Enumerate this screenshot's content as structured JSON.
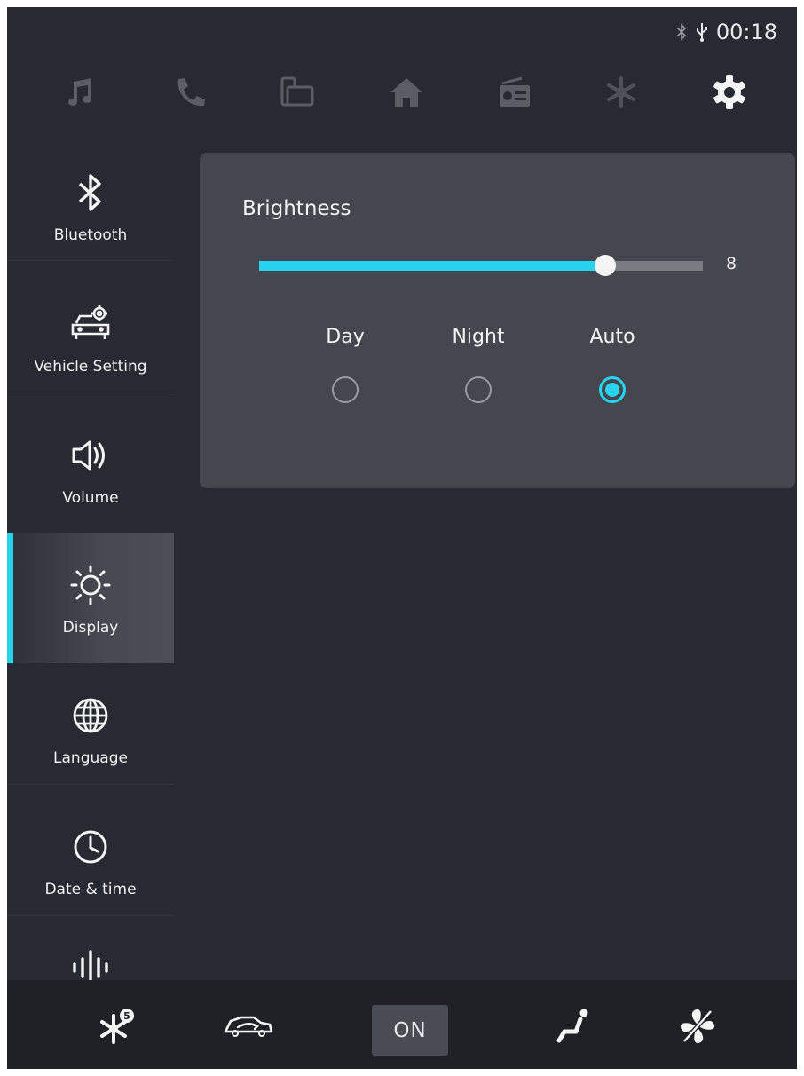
{
  "status": {
    "time": "00:18",
    "icons": [
      "bluetooth-icon",
      "usb-icon"
    ]
  },
  "topnav": {
    "items": [
      {
        "icon": "music-icon",
        "active": false
      },
      {
        "icon": "phone-icon",
        "active": false
      },
      {
        "icon": "screen-mirror-icon",
        "active": false
      },
      {
        "icon": "home-icon",
        "active": false
      },
      {
        "icon": "radio-icon",
        "active": false
      },
      {
        "icon": "climate-icon",
        "active": false
      },
      {
        "icon": "settings-gear-icon",
        "active": true
      }
    ]
  },
  "sidebar": {
    "items": [
      {
        "label": "Bluetooth",
        "icon": "bluetooth-icon"
      },
      {
        "label": "Vehicle Setting",
        "icon": "vehicle-setting-icon"
      },
      {
        "label": "Volume",
        "icon": "speaker-icon"
      },
      {
        "label": "Display",
        "icon": "sun-icon",
        "active": true
      },
      {
        "label": "Language",
        "icon": "globe-icon"
      },
      {
        "label": "Date & time",
        "icon": "clock-icon"
      },
      {
        "label": "",
        "icon": "equalizer-icon"
      }
    ]
  },
  "display": {
    "title": "Brightness",
    "brightness_value": "8",
    "brightness_fraction": 0.78,
    "modes": [
      {
        "label": "Day",
        "selected": false
      },
      {
        "label": "Night",
        "selected": false
      },
      {
        "label": "Auto",
        "selected": true
      }
    ]
  },
  "bottombar": {
    "on_label": "ON",
    "fan_speed_badge": "5",
    "icons": [
      "ac-fan-speed-icon",
      "air-recirculation-icon",
      "on-button",
      "seat-airflow-icon",
      "fan-off-icon"
    ]
  },
  "colors": {
    "accent": "#27d3ef",
    "background": "#272a32",
    "panel": "#45474f",
    "bottom": "#1f2126"
  }
}
